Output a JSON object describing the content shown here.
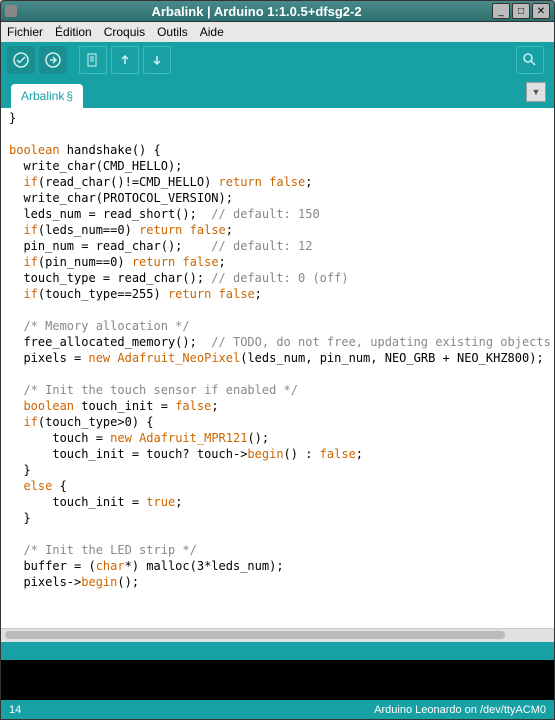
{
  "window": {
    "title": "Arbalink | Arduino 1:1.0.5+dfsg2-2"
  },
  "menu": {
    "file": "Fichier",
    "edit": "Édition",
    "sketch": "Croquis",
    "tools": "Outils",
    "help": "Aide"
  },
  "tab": {
    "name": "Arbalink",
    "modified": "§"
  },
  "footer": {
    "line": "14",
    "board": "Arduino Leonardo on /dev/ttyACM0"
  },
  "code": {
    "l0": "}",
    "l1": "",
    "l2a": "boolean",
    "l2b": " handshake() {",
    "l3": "  write_char(CMD_HELLO);",
    "l4a": "  ",
    "l4b": "if",
    "l4c": "(read_char()!=CMD_HELLO) ",
    "l4d": "return",
    "l4e": " ",
    "l4f": "false",
    "l4g": ";",
    "l5": "  write_char(PROTOCOL_VERSION);",
    "l6a": "  leds_num = read_short();  ",
    "l6b": "// default: 150",
    "l7a": "  ",
    "l7b": "if",
    "l7c": "(leds_num==0) ",
    "l7d": "return",
    "l7e": " ",
    "l7f": "false",
    "l7g": ";",
    "l8a": "  pin_num = read_char();    ",
    "l8b": "// default: 12",
    "l9a": "  ",
    "l9b": "if",
    "l9c": "(pin_num==0) ",
    "l9d": "return",
    "l9e": " ",
    "l9f": "false",
    "l9g": ";",
    "l10a": "  touch_type = read_char(); ",
    "l10b": "// default: 0 (off)",
    "l11a": "  ",
    "l11b": "if",
    "l11c": "(touch_type==255) ",
    "l11d": "return",
    "l11e": " ",
    "l11f": "false",
    "l11g": ";",
    "l12": "",
    "l13a": "  ",
    "l13b": "/* Memory allocation */",
    "l14a": "  free_allocated_memory();  ",
    "l14b": "// TODO, do not free, updating existing objects",
    "l15a": "  pixels = ",
    "l15b": "new",
    "l15c": " ",
    "l15d": "Adafruit_NeoPixel",
    "l15e": "(leds_num, pin_num, NEO_GRB + NEO_KHZ800);",
    "l16": "",
    "l17a": "  ",
    "l17b": "/* Init the touch sensor if enabled */",
    "l18a": "  ",
    "l18b": "boolean",
    "l18c": " touch_init = ",
    "l18d": "false",
    "l18e": ";",
    "l19a": "  ",
    "l19b": "if",
    "l19c": "(touch_type>0) {",
    "l20a": "      touch = ",
    "l20b": "new",
    "l20c": " ",
    "l20d": "Adafruit_MPR121",
    "l20e": "();",
    "l21a": "      touch_init = touch? touch->",
    "l21b": "begin",
    "l21c": "() : ",
    "l21d": "false",
    "l21e": ";",
    "l22": "  }",
    "l23a": "  ",
    "l23b": "else",
    "l23c": " {",
    "l24a": "      touch_init = ",
    "l24b": "true",
    "l24c": ";",
    "l25": "  }",
    "l26": "",
    "l27a": "  ",
    "l27b": "/* Init the LED strip */",
    "l28a": "  buffer = (",
    "l28b": "char",
    "l28c": "*) malloc(3*leds_num);",
    "l29a": "  pixels->",
    "l29b": "begin",
    "l29c": "();"
  }
}
